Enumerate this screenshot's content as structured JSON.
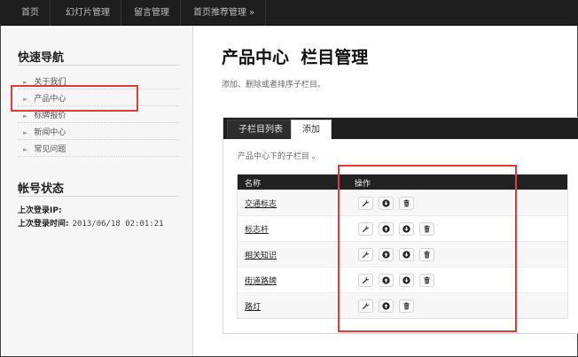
{
  "topnav": {
    "items": [
      "首页",
      "幻灯片管理",
      "留言管理",
      "首页推荐管理 »"
    ]
  },
  "sidebar": {
    "quick_nav_title": "快速导航",
    "links": [
      "关于我们",
      "产品中心",
      "标牌报价",
      "新闻中心",
      "常见问题"
    ],
    "account_title": "帐号状态",
    "last_login_ip_label": "上次登录IP:",
    "last_login_ip_value": "",
    "last_login_time_label": "上次登录时间:",
    "last_login_time_value": "2013/06/18 02:01:21"
  },
  "main": {
    "title": "产品中心  栏目管理",
    "subtitle": "添加、删除或者排序子栏目。",
    "tabs": [
      "子栏目列表",
      "添加"
    ],
    "active_tab": "添加",
    "description": "产品中心下的子栏目 。",
    "table": {
      "headers": [
        "名称",
        "操作"
      ],
      "rows": [
        {
          "name": "交通标志",
          "ops": [
            "wrench-icon",
            "arrow-down-icon",
            "trash-icon"
          ]
        },
        {
          "name": "标志杆",
          "ops": [
            "wrench-icon",
            "arrow-up-icon",
            "arrow-down-icon",
            "trash-icon"
          ]
        },
        {
          "name": "相关知识",
          "ops": [
            "wrench-icon",
            "arrow-up-icon",
            "arrow-down-icon",
            "trash-icon"
          ]
        },
        {
          "name": "街道路牌",
          "ops": [
            "wrench-icon",
            "arrow-up-icon",
            "arrow-down-icon",
            "trash-icon"
          ]
        },
        {
          "name": "路灯",
          "ops": [
            "wrench-icon",
            "arrow-up-icon",
            "trash-icon"
          ]
        }
      ]
    }
  },
  "colors": {
    "topbar": "#1e1e1e",
    "highlight": "#e23b3b",
    "table_header": "#222222"
  }
}
